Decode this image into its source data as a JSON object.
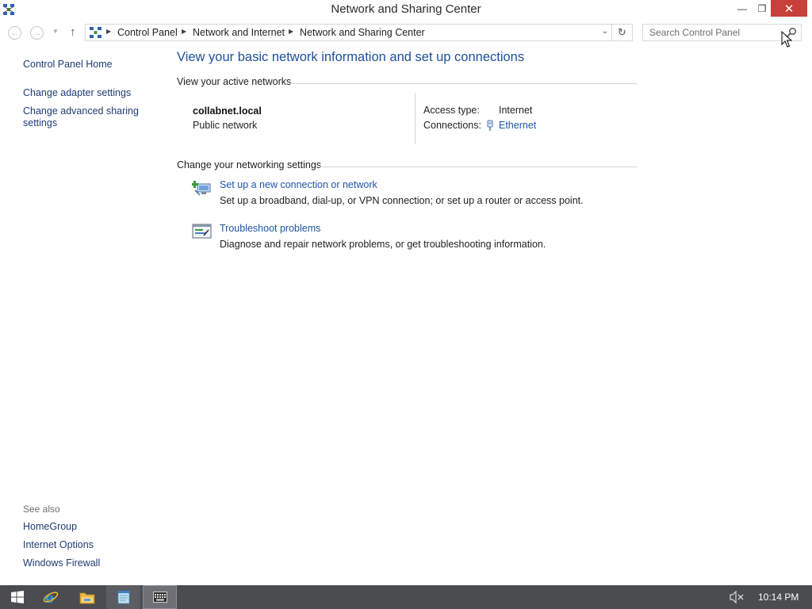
{
  "window": {
    "title": "Network and Sharing Center",
    "minimize_glyph": "—",
    "maximize_glyph": "❐",
    "close_glyph": "✕"
  },
  "navigation": {
    "breadcrumbs": [
      "Control Panel",
      "Network and Internet",
      "Network and Sharing Center"
    ],
    "search_placeholder": "Search Control Panel"
  },
  "left_pane": {
    "home_link": "Control Panel Home",
    "links": [
      "Change adapter settings",
      "Change advanced sharing settings"
    ],
    "see_also_label": "See also",
    "see_also_links": [
      "HomeGroup",
      "Internet Options",
      "Windows Firewall"
    ]
  },
  "main": {
    "title": "View your basic network information and set up connections",
    "active_networks_heading": "View your active networks",
    "network": {
      "name": "collabnet.local",
      "category": "Public network",
      "access_type_label": "Access type:",
      "access_type_value": "Internet",
      "connections_label": "Connections:",
      "connection_name": "Ethernet"
    },
    "settings_heading": "Change your networking settings",
    "tasks": [
      {
        "icon": "new-connection-icon",
        "link": "Set up a new connection or network",
        "description": "Set up a broadband, dial-up, or VPN connection; or set up a router or access point."
      },
      {
        "icon": "troubleshoot-icon",
        "link": "Troubleshoot problems",
        "description": "Diagnose and repair network problems, or get troubleshooting information."
      }
    ]
  },
  "taskbar": {
    "clock": "10:14 PM",
    "items": [
      "start-button",
      "internet-explorer",
      "file-explorer",
      "notepad",
      "on-screen-keyboard"
    ]
  },
  "colors": {
    "link": "#1f55a6",
    "title": "#1c4f9c",
    "close_button": "#c7403a",
    "taskbar": "#4a4c50"
  }
}
